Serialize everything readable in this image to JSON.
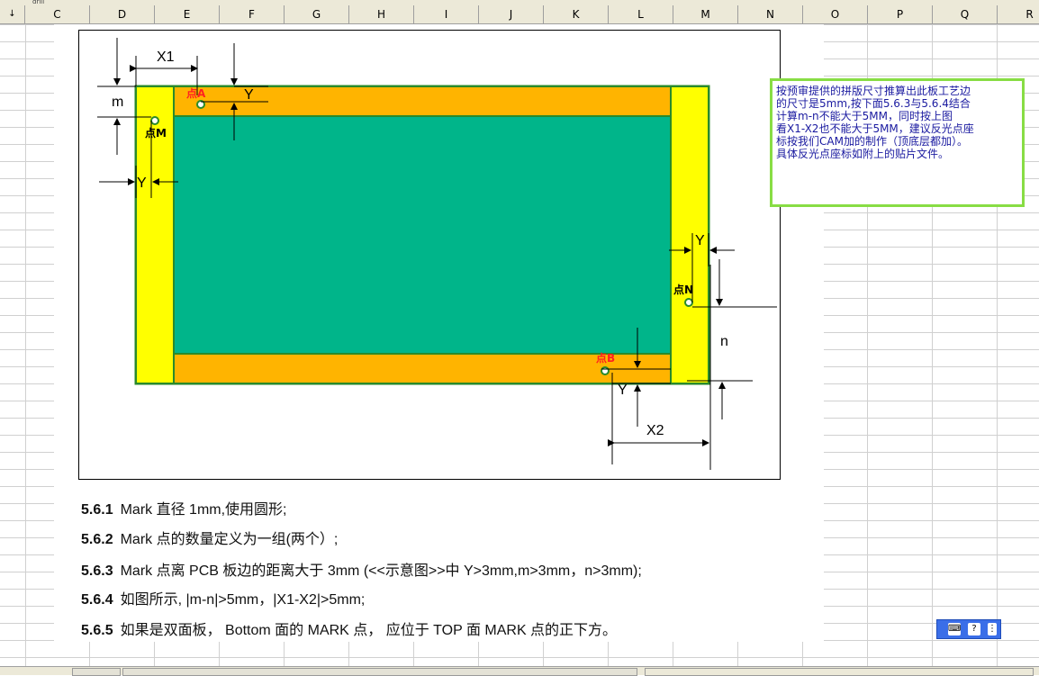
{
  "sheet": {
    "tab_label": "drill",
    "corner_glyph": "↓",
    "columns": [
      "C",
      "D",
      "E",
      "F",
      "G",
      "H",
      "I",
      "J",
      "K",
      "L",
      "M",
      "N",
      "O",
      "P",
      "Q",
      "R"
    ]
  },
  "figure": {
    "x1_label": "X1",
    "x2_label": "X2",
    "m_label": "m",
    "n_label": "n",
    "y_label": "Y",
    "point_a": "点A",
    "point_b": "点B",
    "point_m": "点M",
    "point_n": "点N",
    "colors": {
      "board": "#00b58a",
      "rail_yellow": "#ffff00",
      "rail_orange": "#ffb400",
      "edge": "#2a8a2a"
    }
  },
  "spec_lines": [
    {
      "num": "5.6.1",
      "text": "Mark 直径 1mm,使用圆形;"
    },
    {
      "num": "5.6.2",
      "text": "Mark 点的数量定义为一组(两个）;"
    },
    {
      "num": "5.6.3",
      "text": "Mark 点离 PCB 板边的距离大于 3mm (<<示意图>>中 Y>3mm,m>3mm，n>3mm);"
    },
    {
      "num": "5.6.4",
      "text": "如图所示, |m-n|>5mm，|X1-X2|>5mm;"
    },
    {
      "num": "5.6.5",
      "text": "如果是双面板，  Bottom 面的 MARK 点，  应位于 TOP 面 MARK 点的正下方。"
    }
  ],
  "comment": {
    "lines": [
      "按预审提供的拼版尺寸推算出此板工艺边",
      "的尺寸是5mm,按下面5.6.3与5.6.4结合",
      "计算m-n不能大于5MM，同时按上图",
      "看X1-X2也不能大于5MM，建议反光点座",
      "标按我们CAM加的制作（顶底层都加）。",
      "具体反光点座标如附上的贴片文件。"
    ],
    "border_color": "#88dd44"
  },
  "ime": {
    "icons": [
      "keyboard-icon",
      "help-icon",
      "menu-icon"
    ],
    "help_glyph": "?",
    "keyboard_glyph": "⌨",
    "menu_glyph": "⋮"
  }
}
